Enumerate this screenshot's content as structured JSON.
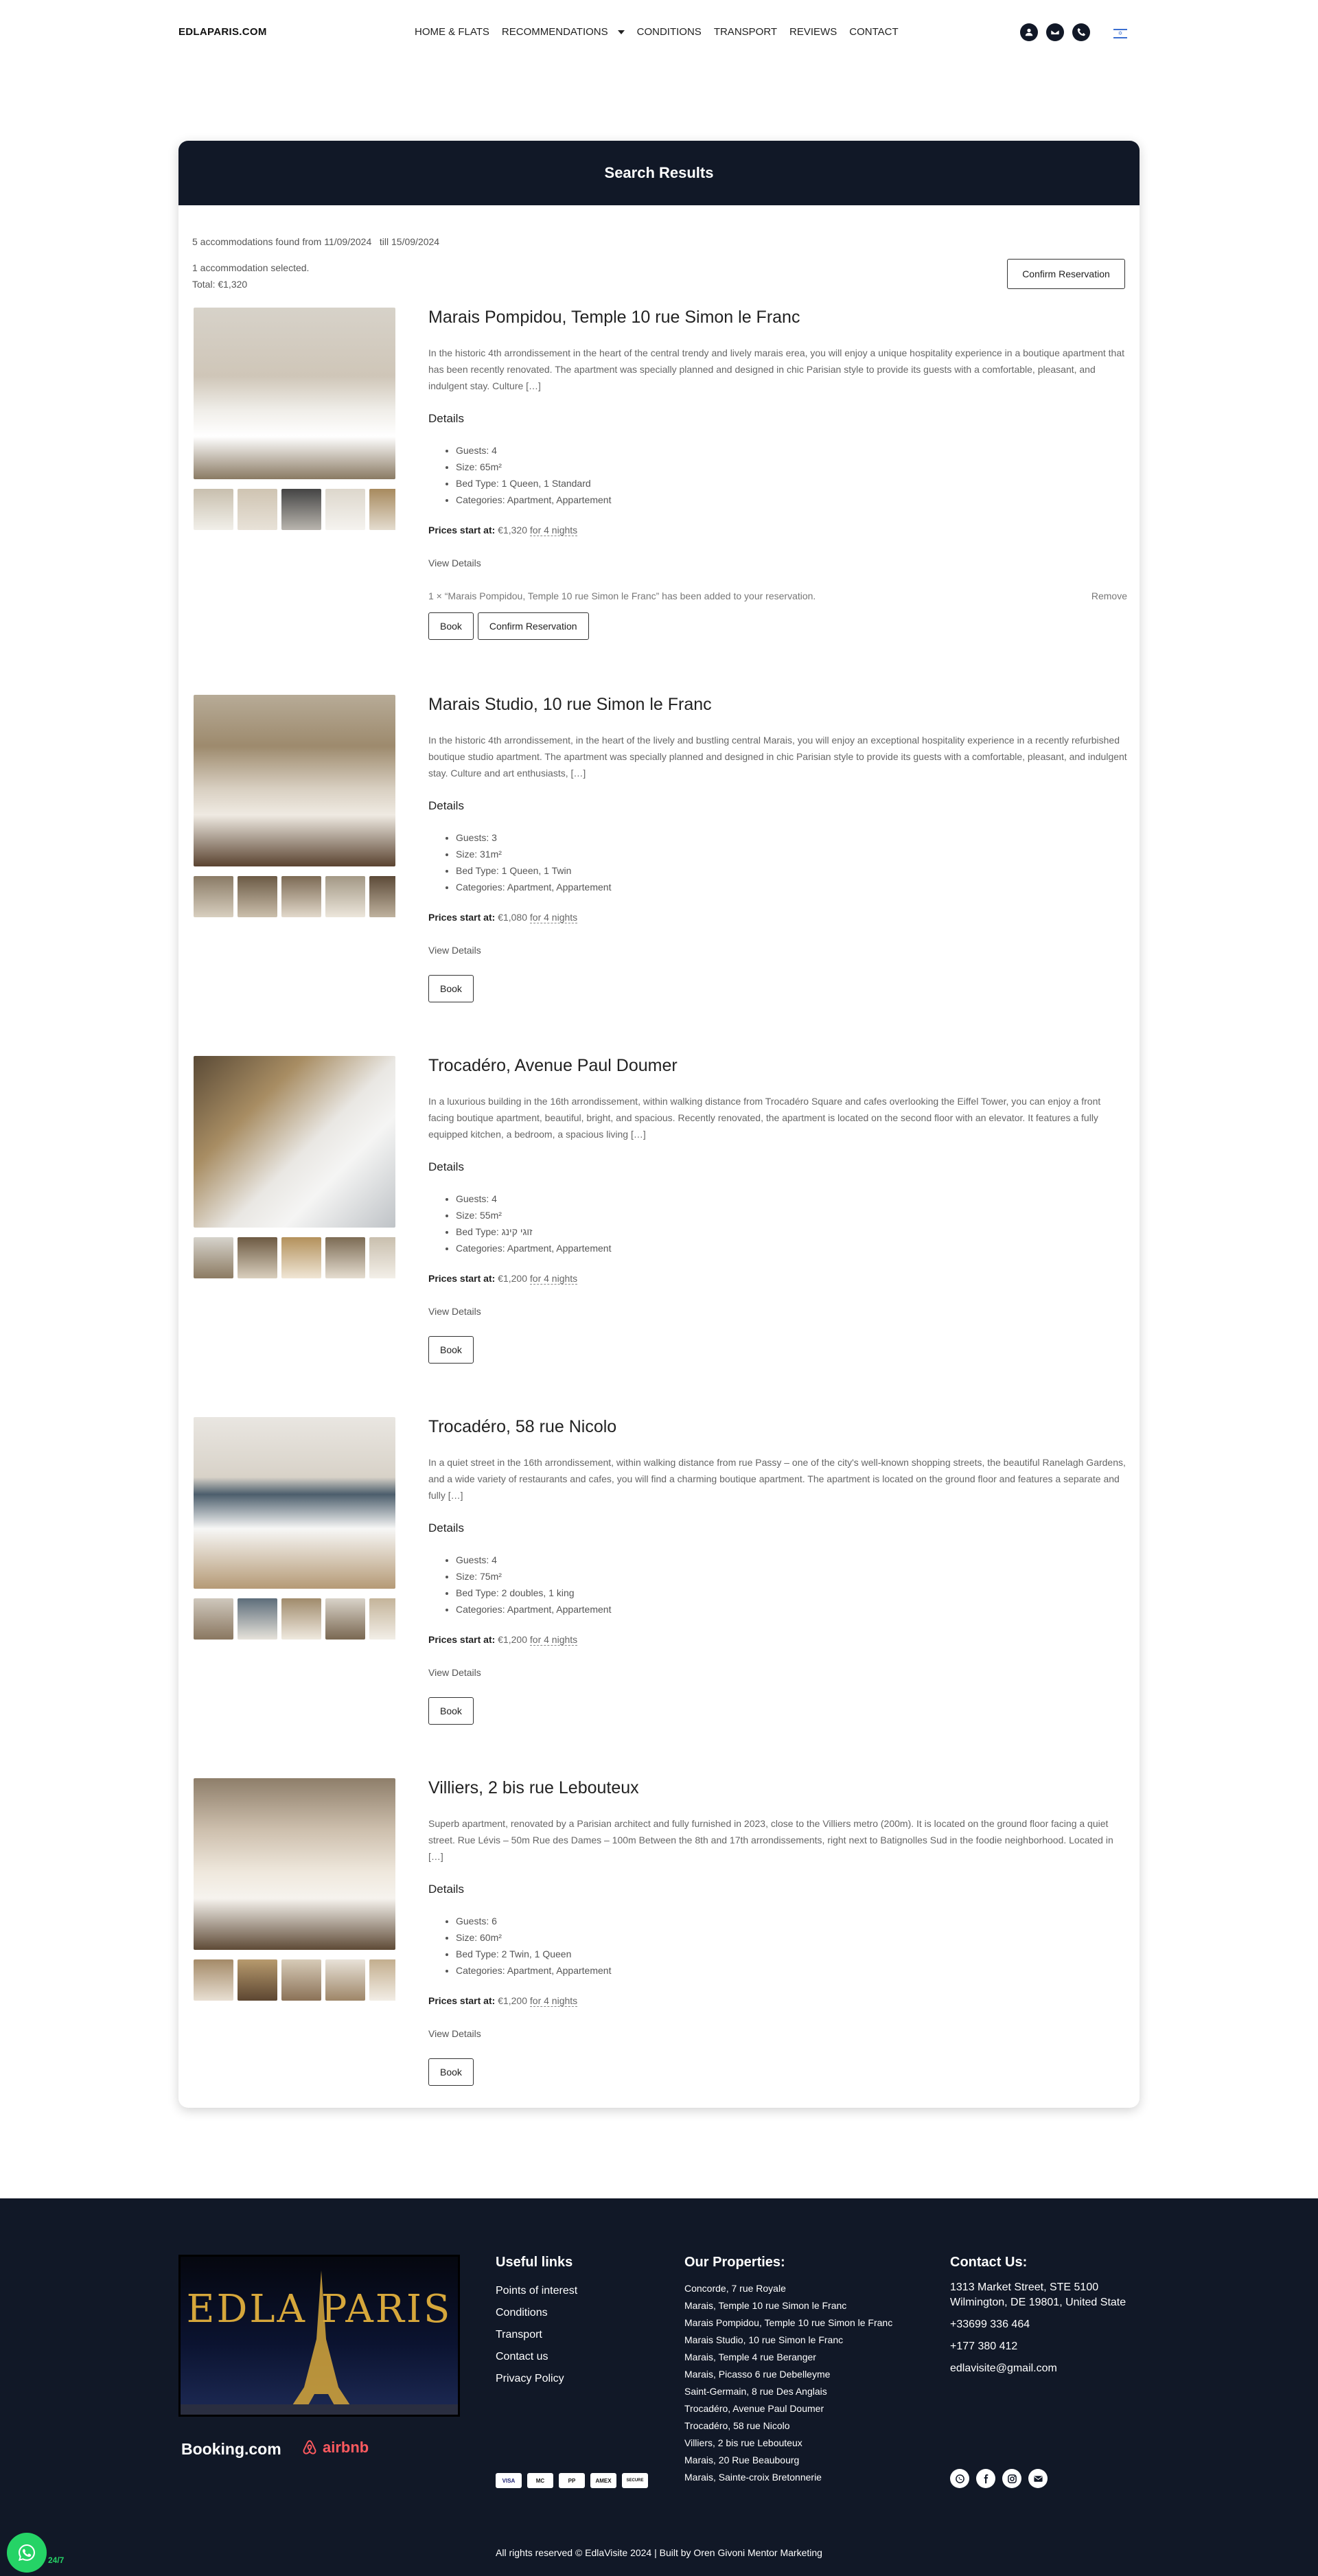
{
  "header": {
    "logo": "EDLAPARIS.COM",
    "nav": [
      "HOME & FLATS",
      "RECOMMENDATIONS",
      "CONDITIONS",
      "TRANSPORT",
      "REVIEWS",
      "CONTACT"
    ],
    "icons": [
      "user-icon",
      "mail-icon",
      "phone-icon"
    ],
    "language_flag": "israel-flag-icon"
  },
  "results": {
    "title": "Search Results",
    "found": "5 accommodations found from 11/09/2024   till 15/09/2024",
    "selected": "1 accommodation selected.",
    "total": "Total: €1,320",
    "confirm_label": "Confirm Reservation",
    "items": [
      {
        "title": "Marais Pompidou, Temple 10 rue Simon le Franc",
        "description": "In the historic 4th arrondissement in the heart of the central trendy and lively marais erea, you will enjoy a unique hospitality experience in a boutique apartment that has been recently renovated. The apartment was specially planned and designed in chic Parisian style to provide its guests with a comfortable, pleasant, and indulgent stay. Culture […]",
        "details_heading": "Details",
        "guests": "Guests: 4",
        "size": "Size: 65m²",
        "bed": "Bed Type: 1 Queen, 1 Standard",
        "categories": "Categories: Apartment, Appartement",
        "price_label": "Prices start at:",
        "price": "€1,320",
        "nights": "for 4 nights",
        "view_details": "View Details",
        "notice": "1 × “Marais Pompidou, Temple 10 rue Simon le Franc” has been added to your reservation.",
        "remove": "Remove",
        "book_label": "Book",
        "confirm_label": "Confirm Reservation"
      },
      {
        "title": "Marais Studio, 10 rue Simon le Franc",
        "description": "In the historic 4th arrondissement, in the heart of the lively and bustling central Marais, you will enjoy an exceptional hospitality experience in a recently refurbished boutique studio apartment. The apartment was specially planned and designed in chic Parisian style to provide its guests with a comfortable, pleasant, and indulgent stay. Culture and art enthusiasts, […]",
        "details_heading": "Details",
        "guests": "Guests: 3",
        "size": "Size: 31m²",
        "bed": "Bed Type: 1 Queen, 1 Twin",
        "categories": "Categories: Apartment, Appartement",
        "price_label": "Prices start at:",
        "price": "€1,080",
        "nights": "for 4 nights",
        "view_details": "View Details",
        "book_label": "Book"
      },
      {
        "title": "Trocadéro, Avenue Paul Doumer",
        "description": "In a luxurious building in the 16th arrondissement, within walking distance from Trocadéro Square and cafes overlooking the Eiffel Tower, you can enjoy a front facing boutique apartment, beautiful, bright, and spacious. Recently renovated, the apartment is located on the second floor with an elevator. It features a fully equipped kitchen, a bedroom, a spacious living […]",
        "details_heading": "Details",
        "guests": "Guests: 4",
        "size": "Size: 55m²",
        "bed": "Bed Type: זוגי קינג",
        "categories": "Categories: Apartment, Appartement",
        "price_label": "Prices start at:",
        "price": "€1,200",
        "nights": "for 4 nights",
        "view_details": "View Details",
        "book_label": "Book"
      },
      {
        "title": "Trocadéro, 58 rue Nicolo",
        "description": "In a quiet street in the 16th arrondissement, within walking distance from rue Passy – one of the city's well-known shopping streets, the beautiful Ranelagh Gardens, and a wide variety of restaurants and cafes, you will find a charming boutique apartment. The apartment is located on the ground floor and features a separate and fully […]",
        "details_heading": "Details",
        "guests": "Guests: 4",
        "size": "Size: 75m²",
        "bed": "Bed Type: 2 doubles, 1 king",
        "categories": "Categories: Apartment, Appartement",
        "price_label": "Prices start at:",
        "price": "€1,200",
        "nights": "for 4 nights",
        "view_details": "View Details",
        "book_label": "Book"
      },
      {
        "title": "Villiers, 2 bis rue Lebouteux",
        "description": "Superb apartment, renovated by a Parisian architect and fully furnished in 2023, close to the Villiers metro (200m). It is located on the ground floor facing a quiet street. Rue Lévis – 50m Rue des Dames – 100m Between the 8th and 17th arrondissements, right next to Batignolles Sud in the foodie neighborhood. Located in […]",
        "details_heading": "Details",
        "guests": "Guests: 6",
        "size": "Size: 60m²",
        "bed": "Bed Type: 2 Twin, 1 Queen",
        "categories": "Categories: Apartment, Appartement",
        "price_label": "Prices start at:",
        "price": "€1,200",
        "nights": "for 4 nights",
        "view_details": "View Details",
        "book_label": "Book"
      }
    ]
  },
  "footer": {
    "logo_text": "EDLA PARIS",
    "booking": "Booking.com",
    "airbnb": "airbnb",
    "useful_links_heading": "Useful links",
    "useful_links": [
      "Points of interest",
      "Conditions",
      "Transport",
      "Contact us",
      "Privacy Policy"
    ],
    "properties_heading": "Our Properties:",
    "properties": [
      "Concorde, 7 rue Royale",
      "Marais, Temple 10 rue Simon le Franc",
      "Marais Pompidou, Temple 10 rue Simon le Franc",
      "Marais Studio, 10 rue Simon le Franc",
      "Marais, Temple 4 rue Beranger",
      "Marais, Picasso 6 rue Debelleyme",
      "Saint-Germain, 8 rue Des Anglais",
      "Trocadéro, Avenue Paul Doumer",
      "Trocadéro, 58 rue Nicolo",
      "Villiers, 2 bis rue Lebouteux",
      "Marais, 20 Rue Beaubourg",
      "Marais, Sainte-croix Bretonnerie"
    ],
    "contact_heading": "Contact Us:",
    "address_1": "1313 Market Street, STE 5100",
    "address_2": "Wilmington, DE 19801, United State",
    "phone_1": "+33699 336 464",
    "phone_2": "+177 380 412",
    "email": "edlavisite@gmail.com",
    "payments": [
      "VISA",
      "MC",
      "PP",
      "AMEX",
      "SECURE"
    ],
    "socials": [
      "whatsapp-icon",
      "facebook-icon",
      "instagram-icon",
      "mail-icon"
    ],
    "copyright": "All rights reserved © EdlaVisite 2024 | Built by Oren Givoni Mentor Marketing",
    "whatsapp_label": "24/7"
  }
}
